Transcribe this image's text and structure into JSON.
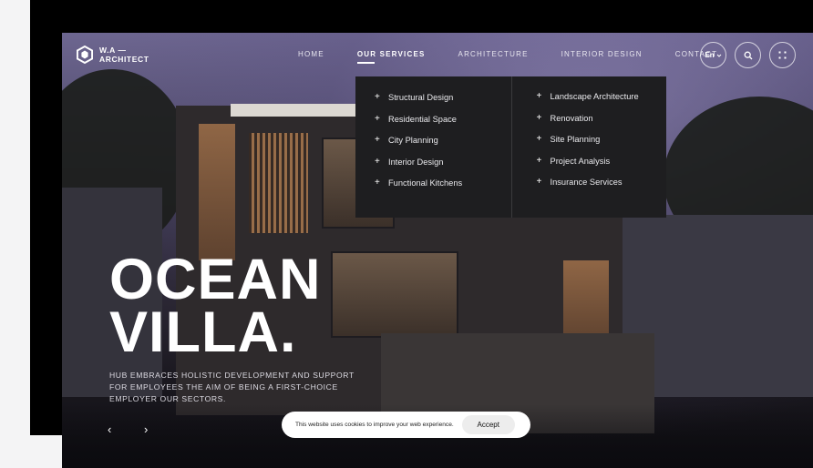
{
  "brand": {
    "line1": "W.A —",
    "line2": "ARCHITECT"
  },
  "nav": [
    {
      "label": "HOME",
      "active": false
    },
    {
      "label": "OUR SERVICES",
      "active": true
    },
    {
      "label": "ARCHITECTURE",
      "active": false
    },
    {
      "label": "INTERIOR DESIGN",
      "active": false
    },
    {
      "label": "CONTACT",
      "active": false
    }
  ],
  "header_actions": {
    "language": "En"
  },
  "services_menu": {
    "column1": [
      "Structural Design",
      "Residential Space",
      "City Planning",
      "Interior Design",
      "Functional Kitchens"
    ],
    "column2": [
      "Landscape Architecture",
      "Renovation",
      "Site Planning",
      "Project Analysis",
      "Insurance Services"
    ]
  },
  "hero": {
    "title_line1": "OCEAN",
    "title_line2": "VILLA.",
    "description_line1": "HUB EMBRACES HOLISTIC DEVELOPMENT AND SUPPORT",
    "description_line2": "FOR EMPLOYEES THE AIM OF BEING A FIRST-CHOICE",
    "description_line3": "EMPLOYER OUR SECTORS."
  },
  "slider": {
    "prev_symbol": "‹",
    "next_symbol": "›"
  },
  "cookie": {
    "message": "This website uses cookies to improve your web experience.",
    "accept_label": "Accept"
  },
  "colors": {
    "dropdown_bg": "#1e1e20",
    "cookie_bg": "#ffffff",
    "panel_black": "#000000"
  }
}
